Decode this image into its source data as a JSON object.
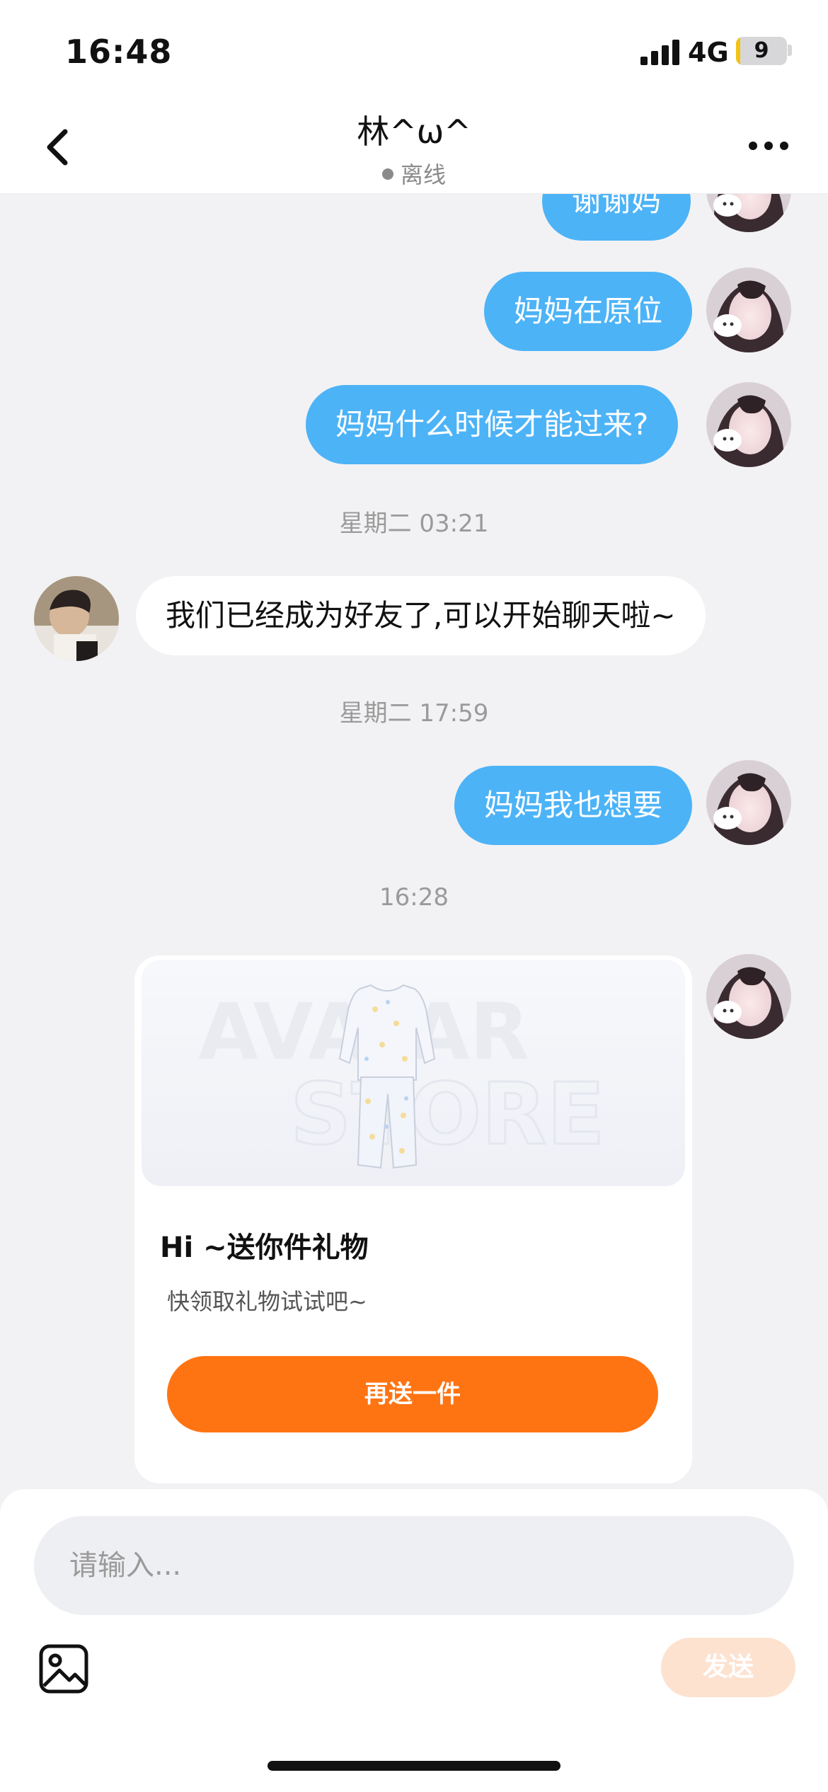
{
  "status_bar": {
    "time": "16:48",
    "network": "4G",
    "battery": "9",
    "battery_level": 0.09
  },
  "header": {
    "title": "林^ω^",
    "status": "离线"
  },
  "messages": [
    {
      "type": "out",
      "text": "谢谢妈"
    },
    {
      "type": "out",
      "text": "妈妈在原位"
    },
    {
      "type": "out",
      "text": "妈妈什么时候才能过来?"
    },
    {
      "type": "time",
      "text": "星期二 03:21"
    },
    {
      "type": "in",
      "text": "我们已经成为好友了,可以开始聊天啦~"
    },
    {
      "type": "time",
      "text": "星期二 17:59"
    },
    {
      "type": "out",
      "text": "妈妈我也想要"
    },
    {
      "type": "time",
      "text": "16:28"
    }
  ],
  "gift_card": {
    "image_text_1": "AVATAR",
    "image_text_2": "STORE",
    "title": "Hi ~送你件礼物",
    "subtitle": "快领取礼物试试吧~",
    "button_label": "再送一件"
  },
  "input": {
    "placeholder": "请输入...",
    "send_label": "发送"
  },
  "colors": {
    "outgoing_bubble": "#4db3f7",
    "gift_button": "#ff7412",
    "send_button_disabled": "#fde2d0"
  }
}
